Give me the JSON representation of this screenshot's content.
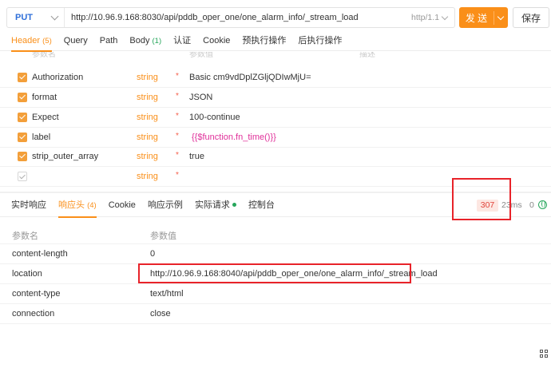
{
  "url_bar": {
    "method": "PUT",
    "url": "http://10.96.9.168:8030/api/pddb_oper_one/one_alarm_info/_stream_load",
    "protocol": "http/1.1",
    "send_label": "发 送",
    "save_label": "保存"
  },
  "request_tabs": [
    {
      "label": "Header",
      "count": "(5)",
      "count_color": "orange",
      "active": true
    },
    {
      "label": "Query",
      "count": "",
      "active": false
    },
    {
      "label": "Path",
      "count": "",
      "active": false
    },
    {
      "label": "Body",
      "count": "(1)",
      "count_color": "green",
      "active": false
    },
    {
      "label": "认证",
      "count": "",
      "active": false
    },
    {
      "label": "Cookie",
      "count": "",
      "active": false
    },
    {
      "label": "预执行操作",
      "count": "",
      "active": false
    },
    {
      "label": "后执行操作",
      "count": "",
      "active": false
    }
  ],
  "header_columns_faded": [
    "参数名",
    "参数值",
    "描述"
  ],
  "header_rows": [
    {
      "checked": true,
      "key": "Authorization",
      "type": "string",
      "required": "*",
      "value": "Basic cm9vdDplZGljQDIwMjU="
    },
    {
      "checked": true,
      "key": "format",
      "type": "string",
      "required": "*",
      "value": "JSON"
    },
    {
      "checked": true,
      "key": "Expect",
      "type": "string",
      "required": "*",
      "value": "100-continue"
    },
    {
      "checked": true,
      "key": "label",
      "type": "string",
      "required": "*",
      "value": "{{$function.fn_time()}}"
    },
    {
      "checked": true,
      "key": "strip_outer_array",
      "type": "string",
      "required": "*",
      "value": "true"
    },
    {
      "checked": false,
      "key": "",
      "type": "string",
      "required": "*",
      "value": ""
    }
  ],
  "response_tabs": [
    {
      "label": "实时响应",
      "count": "",
      "active": false
    },
    {
      "label": "响应头",
      "count": "(4)",
      "active": true
    },
    {
      "label": "Cookie",
      "count": "",
      "active": false
    },
    {
      "label": "响应示例",
      "count": "",
      "active": false
    },
    {
      "label": "实际请求",
      "count": "",
      "dot": true,
      "active": false
    },
    {
      "label": "控制台",
      "count": "",
      "active": false
    }
  ],
  "status": {
    "code": "307",
    "time": "23ms",
    "size": "0"
  },
  "response_headers": {
    "col_name": "参数名",
    "col_value": "参数值",
    "rows": [
      {
        "name": "content-length",
        "value": "0"
      },
      {
        "name": "location",
        "value": "http://10.96.9.168:8040/api/pddb_oper_one/one_alarm_info/_stream_load"
      },
      {
        "name": "content-type",
        "value": "text/html"
      },
      {
        "name": "connection",
        "value": "close"
      }
    ]
  },
  "colors": {
    "accent": "#fa8f19",
    "method": "#2f6fd9",
    "highlight_box": "#e8232a",
    "status_text": "#e0433a",
    "function_value": "#e0309a"
  },
  "icons": {
    "send_dropdown": "chevron-down-icon",
    "method_dropdown": "chevron-down-icon",
    "network": "globe-icon",
    "bottom_right": "grid-icon"
  }
}
